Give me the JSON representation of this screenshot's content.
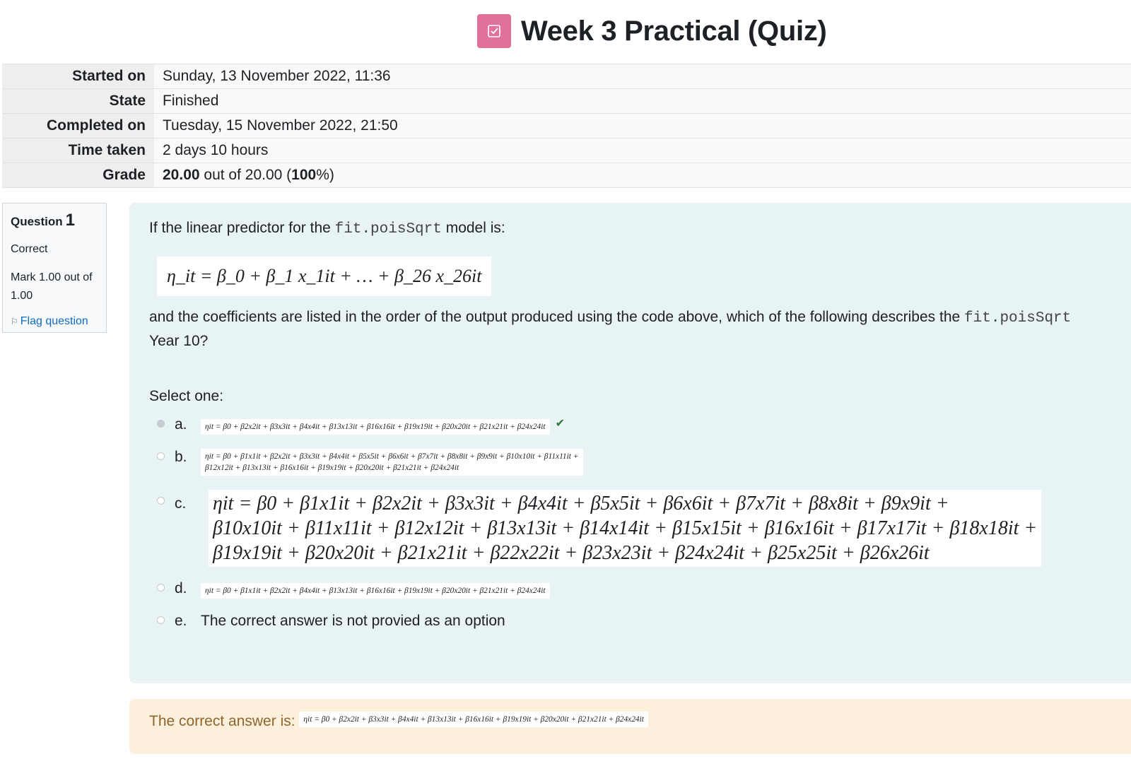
{
  "page": {
    "title": "Week 3 Practical (Quiz)",
    "icon": "quiz-checkbox-icon",
    "icon_color": "#e0719b"
  },
  "summary": [
    {
      "label": "Started on",
      "value": "Sunday, 13 November 2022, 11:36"
    },
    {
      "label": "State",
      "value": "Finished"
    },
    {
      "label": "Completed on",
      "value": "Tuesday, 15 November 2022, 21:50"
    },
    {
      "label": "Time taken",
      "value": "2 days 10 hours"
    }
  ],
  "grade": {
    "label": "Grade",
    "score": "20.00",
    "mid": " out of 20.00 (",
    "percent": "100",
    "tail": "%)"
  },
  "question": {
    "label": "Question",
    "number": "1",
    "state": "Correct",
    "mark": "Mark 1.00 out of 1.00",
    "flag_label": "Flag question",
    "text_pre": "If the linear predictor for the ",
    "code": "fit.poisSqrt",
    "text_post": " model is:",
    "equation": "η_it = β_0 + β_1 x_1it + … + β_26 x_26it",
    "text2_pre": "and the coefficients are listed in the order of the output produced using the code above, which of the following describes the ",
    "code2": "fit.poisSqrt",
    "text2_post": "",
    "text3": "Year 10?",
    "select_prompt": "Select one:",
    "options": [
      {
        "letter": "a.",
        "checked": true,
        "correct_mark": "check-icon",
        "text": "ηit = β0 + β2x2it + β3x3it + β4x4it + β13x13it + β16x16it + β19x19it + β20x20it + β21x21it + β24x24it"
      },
      {
        "letter": "b.",
        "checked": false,
        "text_line1": "ηit = β0 + β1x1it + β2x2it + β3x3it + β4x4it + β5x5it + β6x6it + β7x7it + β8x8it + β9x9it + β10x10it + β11x11it +",
        "text_line2": "β12x12it + β13x13it + β16x16it + β19x19it + β20x20it + β21x21it + β24x24it"
      },
      {
        "letter": "c.",
        "checked": false,
        "text_line1": "ηit  =  β0 + β1x1it + β2x2it + β3x3it + β4x4it + β5x5it + β6x6it + β7x7it + β8x8it + β9x9it +",
        "text_line2": "β10x10it + β11x11it + β12x12it + β13x13it + β14x14it + β15x15it + β16x16it + β17x17it + β18x18it +",
        "text_line3": "β19x19it + β20x20it + β21x21it + β22x22it + β23x23it + β24x24it + β25x25it + β26x26it"
      },
      {
        "letter": "d.",
        "checked": false,
        "text": "ηit = β0 + β1x1it + β2x2it + β4x4it + β13x13it + β16x16it + β19x19it + β20x20it + β21x21it + β24x24it"
      },
      {
        "letter": "e.",
        "checked": false,
        "text": "The correct answer is not provied as an option"
      }
    ]
  },
  "right_answer": {
    "label": "The correct answer is: ",
    "text": "ηit = β0 + β2x2it + β3x3it + β4x4it + β13x13it + β16x16it + β19x19it + β20x20it + β21x21it + β24x24it"
  }
}
